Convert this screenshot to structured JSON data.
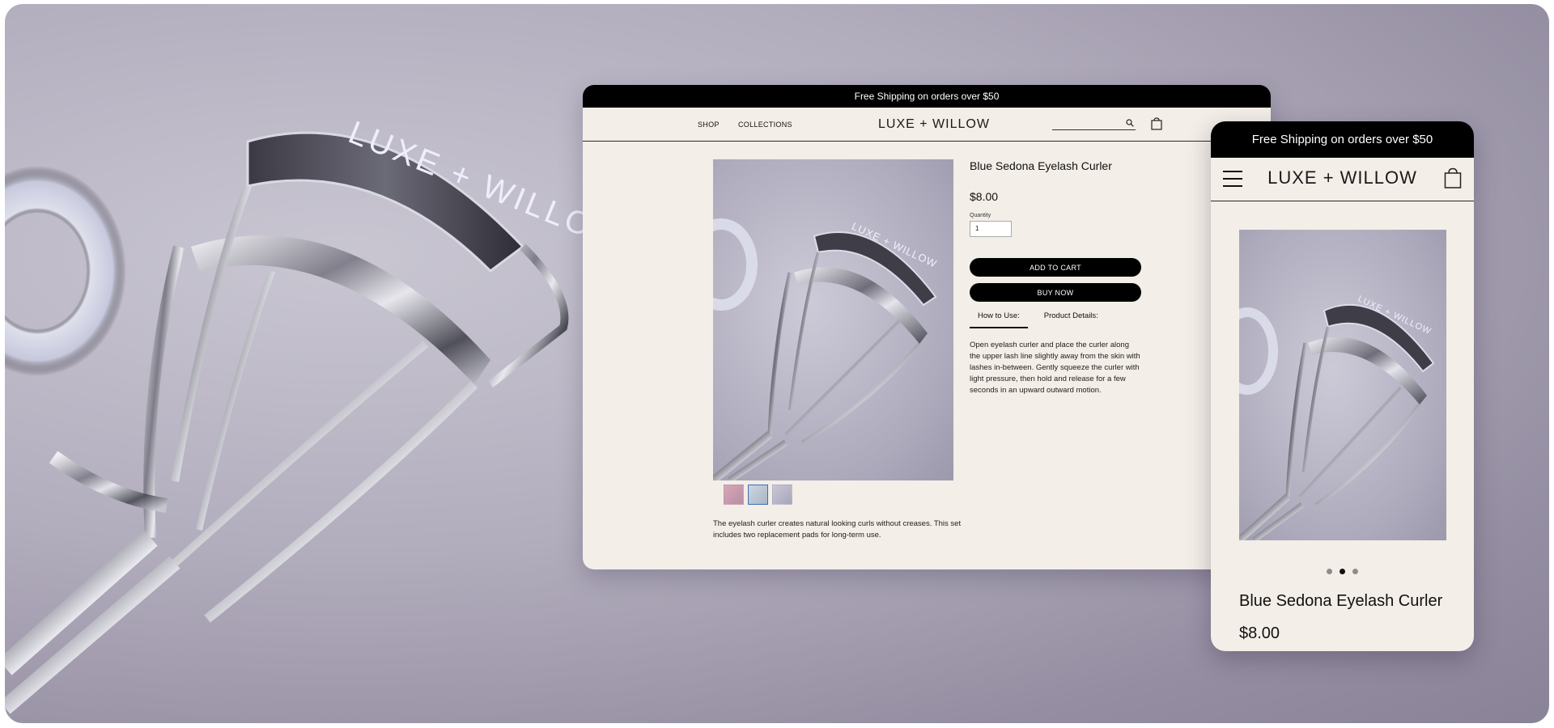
{
  "promo_text": "Free Shipping on orders over $50",
  "brand": "LUXE + WILLOW",
  "nav": {
    "shop": "SHOP",
    "collections": "COLLECTIONS"
  },
  "product": {
    "title": "Blue Sedona Eyelash Curler",
    "price": "$8.00",
    "quantity_label": "Quantity",
    "quantity_value": "1",
    "add_to_cart": "ADD TO CART",
    "buy_now": "BUY NOW",
    "tabs": [
      {
        "label": "How to Use:",
        "active": true
      },
      {
        "label": "Product Details:",
        "active": false
      }
    ],
    "how_to_use": "Open eyelash curler and place the curler along the upper lash line slightly away from the skin with lashes in-between. Gently squeeze the curler with light pressure, then hold and release for a few seconds in an upward outward motion.",
    "description": "The eyelash curler creates natural looking curls without creases. This set includes two replacement pads for long-term use.",
    "thumbnails": 3,
    "selected_thumbnail": 2
  },
  "mobile": {
    "carousel_dots": 3,
    "active_dot": 2
  },
  "icons": [
    "search-icon",
    "cart-icon",
    "menu-icon"
  ],
  "colors": {
    "promo_bar": "#000000",
    "page_background": "#f3eee7",
    "button": "#000000",
    "backdrop": "#b2adbd"
  }
}
